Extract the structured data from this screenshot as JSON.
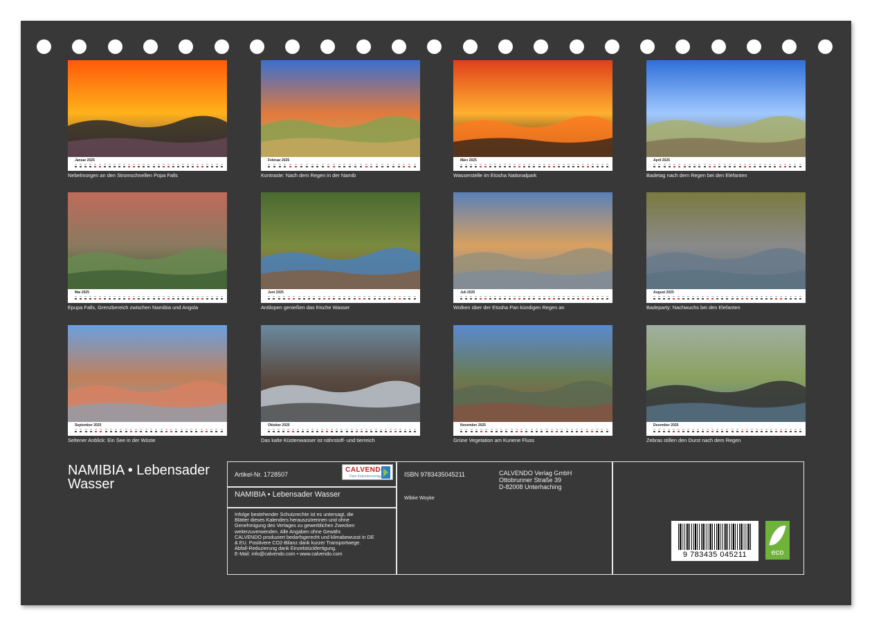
{
  "chart_data": {
    "type": "table",
    "title": "NAMIBIA • Lebensader Wasser",
    "months": [
      {
        "month": "Januar",
        "year": "2025",
        "caption": "Nebelmorgen an den Stromschnellen Popa Falls",
        "days": 31
      },
      {
        "month": "Februar",
        "year": "2025",
        "caption": "Kontraste: Nach dem Regen in der Namib",
        "days": 28
      },
      {
        "month": "März",
        "year": "2025",
        "caption": "Wasserstelle im Etosha Nationalpark",
        "days": 31
      },
      {
        "month": "April",
        "year": "2025",
        "caption": "Badetag nach dem Regen bei den Elefanten",
        "days": 30
      },
      {
        "month": "Mai",
        "year": "2025",
        "caption": "Epupa Falls, Grenzbereich zwischen Namibia und Angola",
        "days": 31
      },
      {
        "month": "Juni",
        "year": "2025",
        "caption": "Antilopen genießen das frische Wasser",
        "days": 30
      },
      {
        "month": "Juli",
        "year": "2025",
        "caption": "Wolken über der Etosha Pan kündigen Regen an",
        "days": 31
      },
      {
        "month": "August",
        "year": "2025",
        "caption": "Badeparty: Nachwuchs bei den Elefanten",
        "days": 31
      },
      {
        "month": "September",
        "year": "2025",
        "caption": "Seltener Anblick: Ein See in der Wüste",
        "days": 30
      },
      {
        "month": "Oktober",
        "year": "2025",
        "caption": "Das kalte Küstenwasser ist nährstoff- und tierreich",
        "days": 31
      },
      {
        "month": "November",
        "year": "2025",
        "caption": "Grüne Vegetation am Kunene Fluss",
        "days": 30
      },
      {
        "month": "Dezember",
        "year": "2025",
        "caption": "Zebras stillen den Durst nach dem Regen",
        "days": 31
      }
    ]
  },
  "title_line1": "NAMIBIA • Lebensader",
  "title_line2": "Wasser",
  "info": {
    "article": "Artikel-Nr. 1728507",
    "product_title": "NAMIBIA • Lebensader Wasser",
    "legal": [
      "Infolge bestehender Schutzrechte ist es untersagt, die",
      "Blätter dieses Kalenders herauszutrennen und ohne",
      "Genehmigung des Verlages zu gewerblichen Zwecken",
      "weiterzuverwenden. Alle Angaben ohne Gewähr.",
      "CALVENDO produziert bedarfsgerecht und klimabewusst in DE",
      "& EU. Positivere CO2-Bilanz dank kurzer Transportwege.",
      "Abfall-Reduzierung dank Einzelstückfertigung.",
      "E-Mail: info@calvendo.com • www.calvendo.com"
    ],
    "isbn": "ISBN 9783435045211",
    "author": "Wibke Woyke",
    "publisher": [
      "CALVENDO Verlag GmbH",
      "Ottobrunner Straße 39",
      "D-82008 Unterhaching"
    ],
    "barcode_number": "9 783435 045211",
    "logo_word": "CALVENDO",
    "logo_sub": "Dein Kalenderverlag",
    "eco_label": "eco"
  },
  "icons": {
    "holes": "binding-hole",
    "logo": "calvendo-logo",
    "eco": "eco-leaf-icon"
  },
  "colors": {
    "sheet": "#383838",
    "caption": "#f2f2f2",
    "weekend": "#dd3333"
  }
}
